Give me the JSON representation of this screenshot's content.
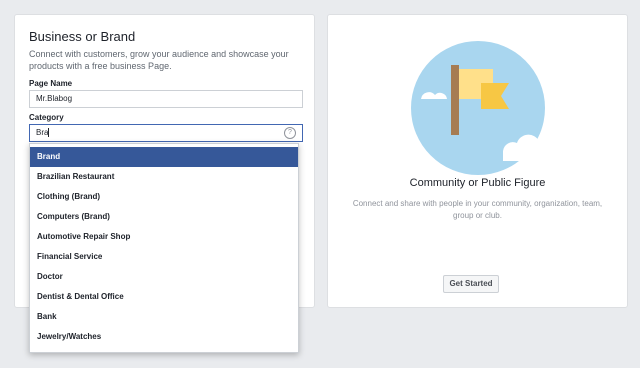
{
  "business": {
    "title": "Business or Brand",
    "description": "Connect with customers, grow your audience and showcase your products with a free business Page.",
    "page_name_label": "Page Name",
    "page_name_value": "Mr.Blabog",
    "category_label": "Category",
    "category_value": "Bra",
    "help_icon": "question-mark-icon"
  },
  "dropdown": {
    "options": [
      "Brand",
      "Brazilian Restaurant",
      "Clothing (Brand)",
      "Computers (Brand)",
      "Automotive Repair Shop",
      "Financial Service",
      "Doctor",
      "Dentist & Dental Office",
      "Bank",
      "Jewelry/Watches"
    ],
    "selected": "Brand"
  },
  "community": {
    "title": "Community or Public Figure",
    "description": "Connect and share with people in your community, organization, team, group or club.",
    "button_label": "Get Started",
    "illustration": "flag-icon"
  },
  "colors": {
    "page_bg": "#e9ebee",
    "selected_bg": "#365899",
    "circle": "#a9d6ef",
    "flag": "#f7c744",
    "pole": "#a67c52"
  }
}
